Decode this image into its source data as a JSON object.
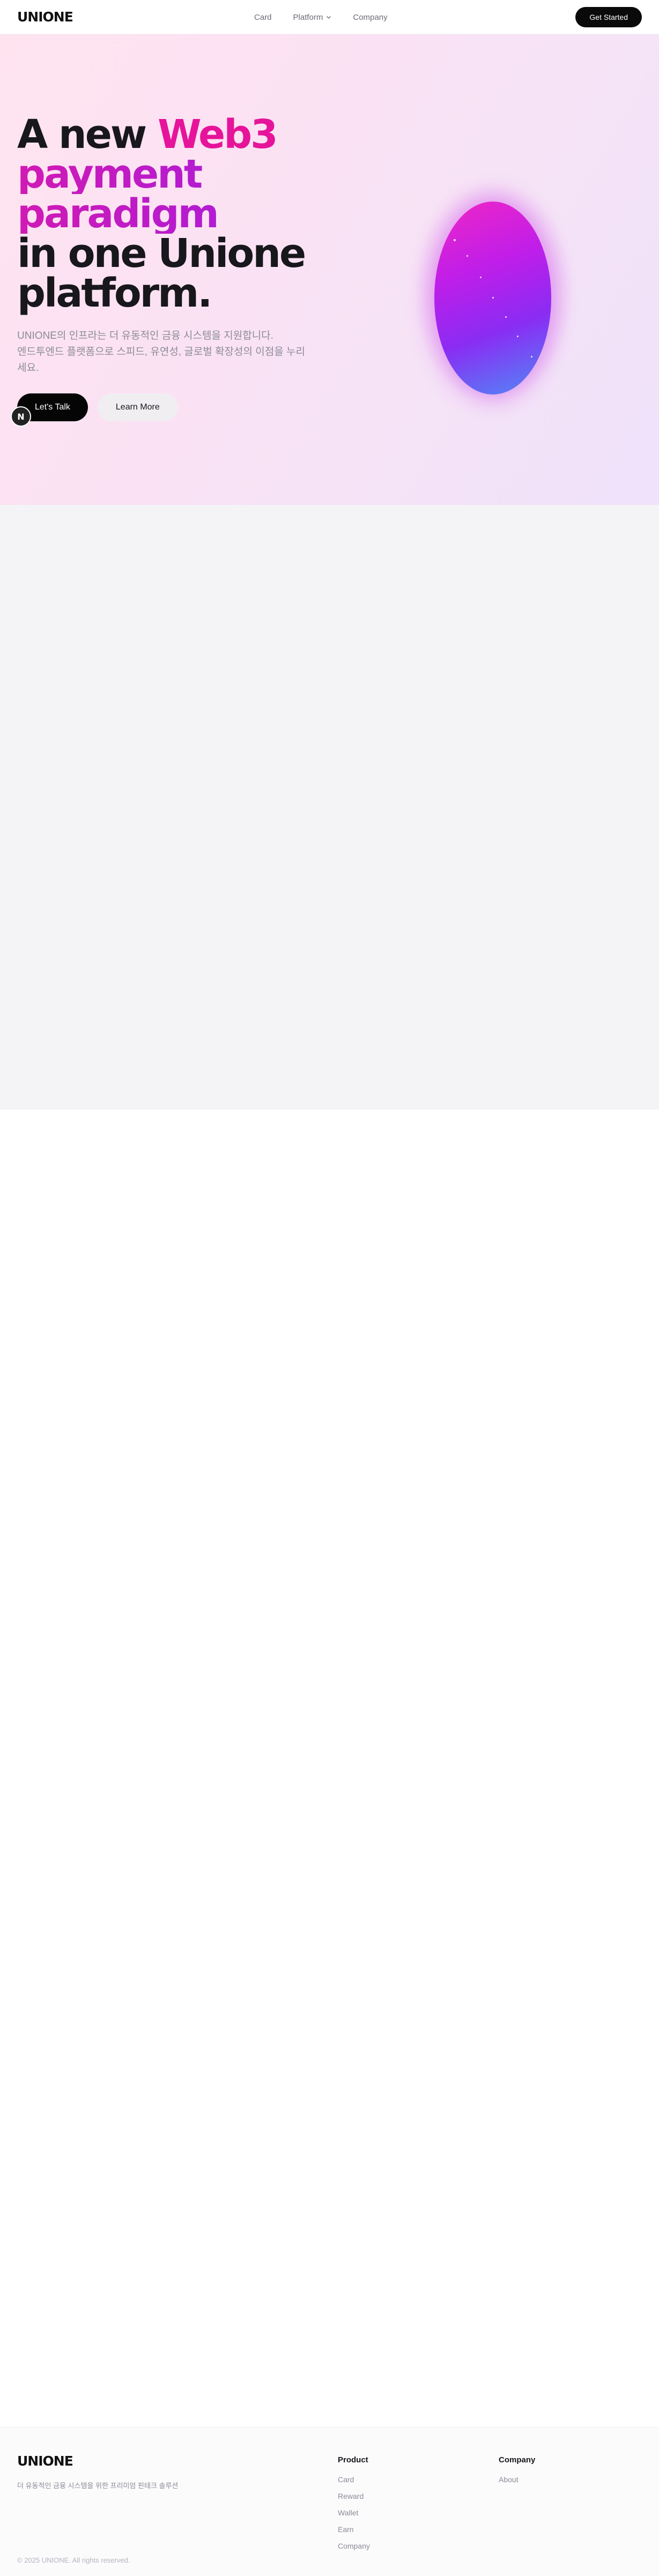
{
  "brand": {
    "logo": "UNIONE"
  },
  "nav": {
    "links": [
      {
        "label": "Card"
      },
      {
        "label": "Platform",
        "has_dropdown": true
      },
      {
        "label": "Company"
      }
    ],
    "cta": "Get Started"
  },
  "hero": {
    "title_line1_plain": "A new ",
    "title_line1_accent": "Web3",
    "title_line2": "payment",
    "title_line3": "paradigm",
    "title_line4": "in one Unione",
    "title_line5": "platform.",
    "desc_line1": "UNIONE의 인프라는 더 유동적인 금융 시스템을 지원합니다.",
    "desc_line2": "엔드투엔드 플랫폼으로 스피드, 유연성, 글로벌 확장성의 이점을 누리",
    "desc_line3": "세요.",
    "primary_button": "Let's Talk",
    "secondary_button": "Learn More",
    "fab_label": "N"
  },
  "colors": {
    "accent_pink": "#e6149a",
    "accent_purple": "#a31ce0",
    "button_dark": "#0a0a0a"
  },
  "footer": {
    "logo": "UNIONE",
    "tagline": "더 유동적인 금융 시스템을 위한 프리미엄 핀테크 솔루션",
    "columns": [
      {
        "title": "Product",
        "items": [
          "Card",
          "Reward",
          "Wallet",
          "Earn",
          "Company"
        ]
      },
      {
        "title": "Company",
        "items": [
          "About"
        ]
      }
    ],
    "copyright": "© 2025 UNIONE. All rights reserved."
  }
}
